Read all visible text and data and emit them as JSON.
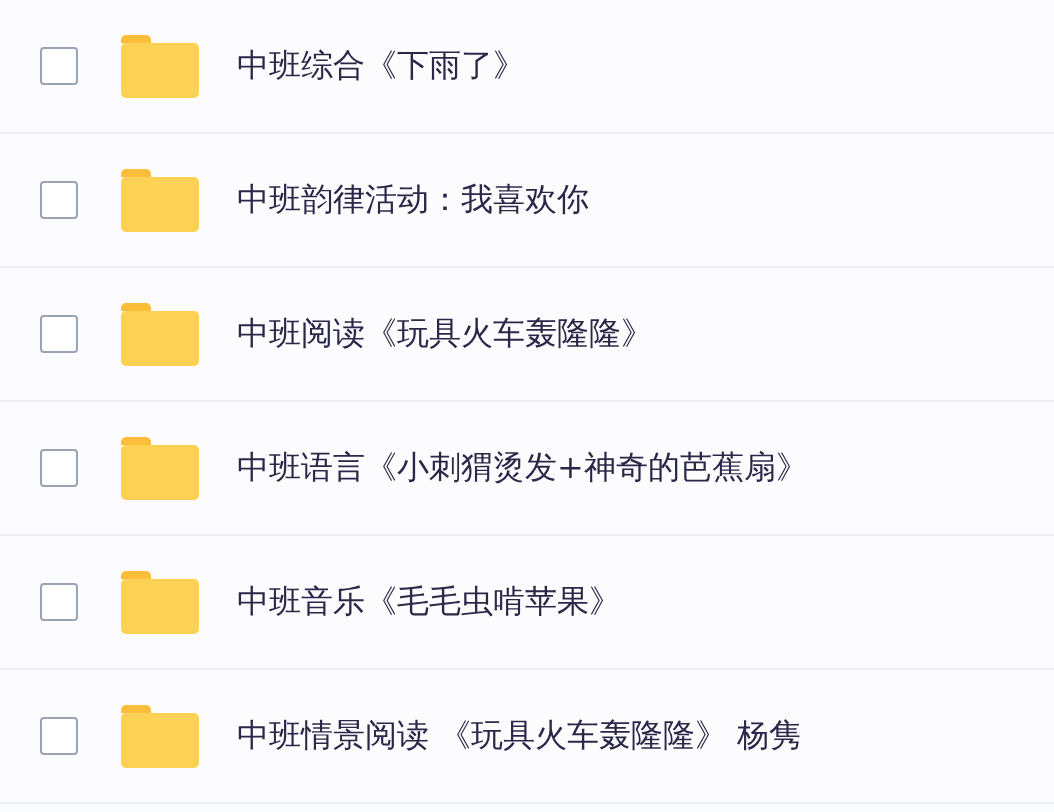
{
  "files": [
    {
      "name": "中班综合《下雨了》",
      "checked": false
    },
    {
      "name": "中班韵律活动：我喜欢你",
      "checked": false
    },
    {
      "name": "中班阅读《玩具火车轰隆隆》",
      "checked": false
    },
    {
      "name": "中班语言《小刺猬烫发+神奇的芭蕉扇》",
      "checked": false
    },
    {
      "name": "中班音乐《毛毛虫啃苹果》",
      "checked": false
    },
    {
      "name": "中班情景阅读 《玩具火车轰隆隆》 杨隽",
      "checked": false
    }
  ]
}
